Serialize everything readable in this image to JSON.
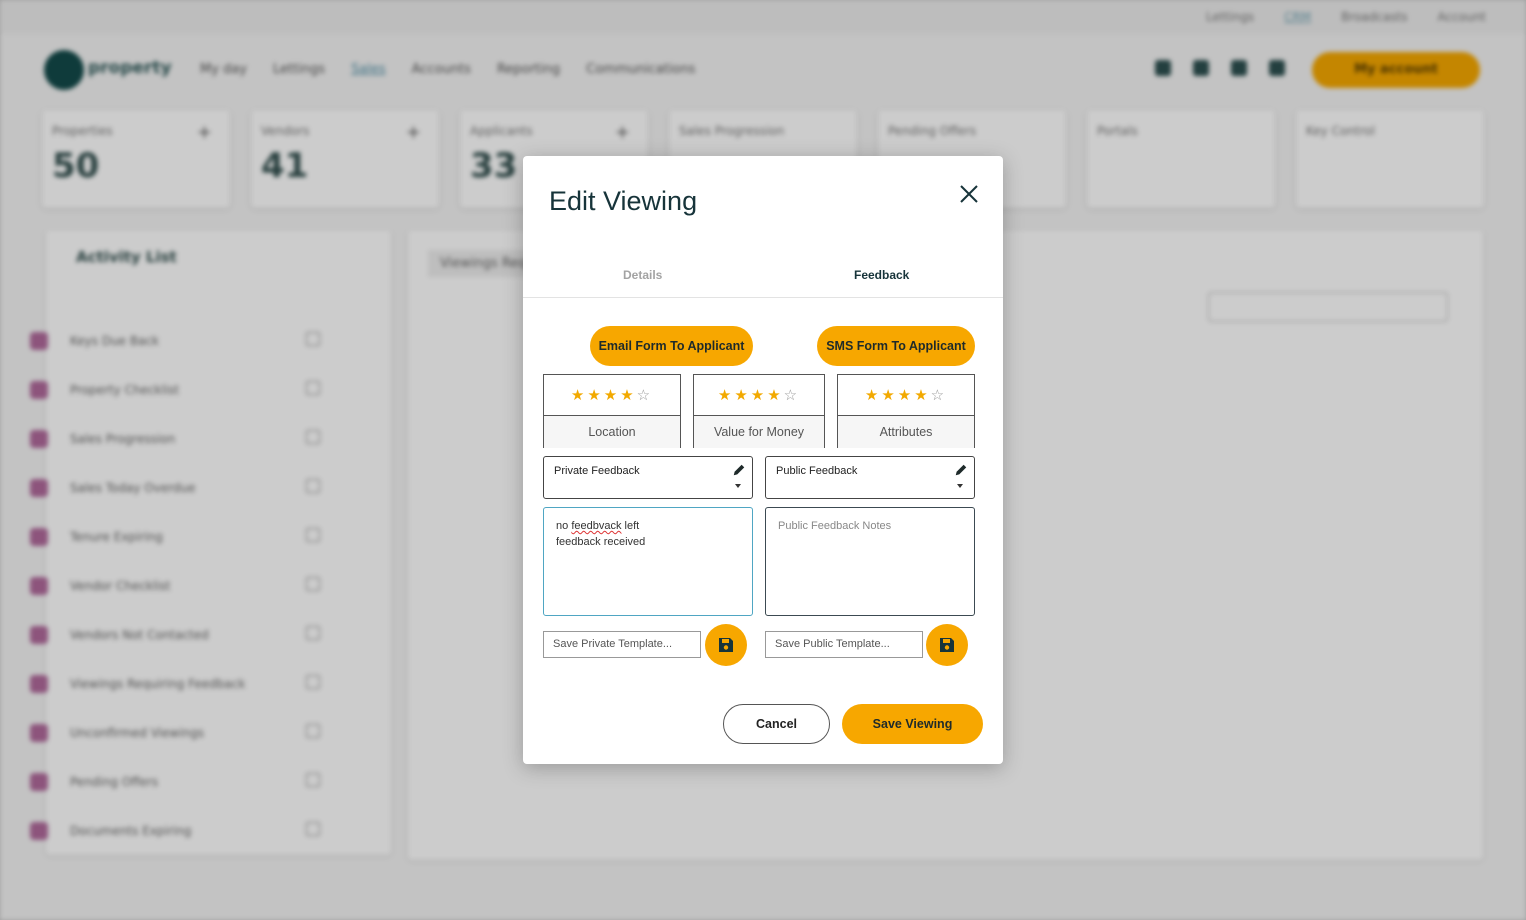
{
  "background": {
    "top_links": [
      "Lettings",
      "CRM",
      "Broadcasts",
      "Account"
    ],
    "brand": "property",
    "nav": [
      "My day",
      "Lettings",
      "Sales",
      "Accounts",
      "Reporting",
      "Communications"
    ],
    "account_button": "My account",
    "stats": [
      {
        "label": "Properties",
        "value": "50"
      },
      {
        "label": "Vendors",
        "value": "41"
      },
      {
        "label": "Applicants",
        "value": "33"
      },
      {
        "label": "Sales Progression",
        "value": ""
      },
      {
        "label": "Pending Offers",
        "value": ""
      },
      {
        "label": "Portals",
        "value": ""
      },
      {
        "label": "Key Control",
        "value": ""
      }
    ],
    "activity_title": "Activity List",
    "activity_items": [
      "Keys Due Back",
      "Property Checklist",
      "Sales Progression",
      "Sales Today Overdue",
      "Tenure Expiring",
      "Vendor Checklist",
      "Vendors Not Contacted",
      "Viewings Requiring Feedback",
      "Unconfirmed Viewings",
      "Pending Offers",
      "Documents Expiring"
    ],
    "viewings_tab": "Viewings Requiring"
  },
  "modal": {
    "title": "Edit Viewing",
    "tabs": {
      "details": "Details",
      "feedback": "Feedback"
    },
    "email_button": "Email Form To Applicant",
    "sms_button": "SMS Form To Applicant",
    "ratings": [
      {
        "label": "Location",
        "stars": 4,
        "max": 5
      },
      {
        "label": "Value for Money",
        "stars": 4,
        "max": 5
      },
      {
        "label": "Attributes",
        "stars": 4,
        "max": 5
      }
    ],
    "private_feedback_label": "Private Feedback",
    "public_feedback_label": "Public Feedback",
    "private_notes_line1_word": "feedbvack",
    "private_notes_line1_prefix": "no",
    "private_notes_line1_suffix": "left",
    "private_notes_line2": "feedback received",
    "public_notes_placeholder": "Public Feedback Notes",
    "private_template_placeholder": "Save Private Template...",
    "public_template_placeholder": "Save Public Template...",
    "cancel_label": "Cancel",
    "save_label": "Save Viewing"
  },
  "colors": {
    "accent": "#f7a700",
    "title": "#17343a",
    "focus_border": "#4fa6c3"
  }
}
